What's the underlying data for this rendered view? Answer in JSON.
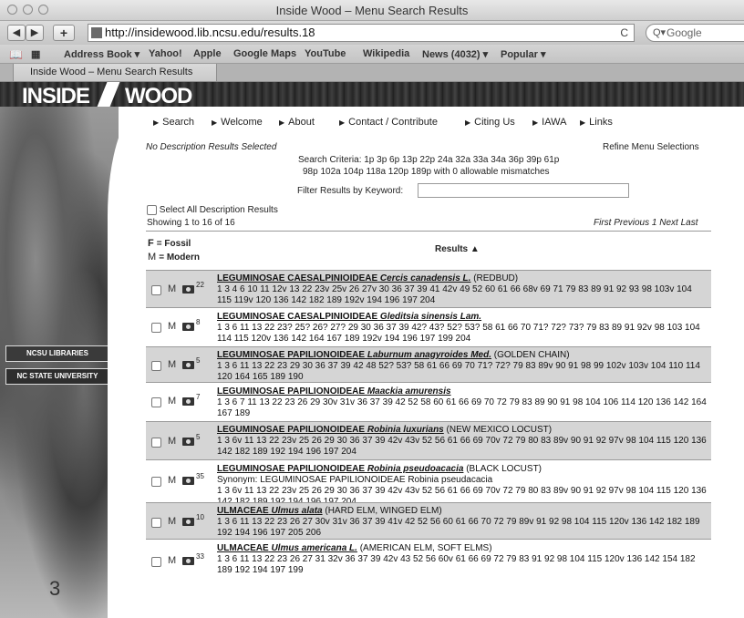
{
  "browser": {
    "window_title": "Inside Wood – Menu Search Results",
    "url": "http://insidewood.lib.ncsu.edu/results.18",
    "search_placeholder": "Google",
    "tab_title": "Inside Wood – Menu Search Results",
    "bookmarks": [
      "Address Book ▾",
      "Yahoo!",
      "Apple",
      "Google Maps",
      "YouTube",
      "Wikipedia",
      "News (4032) ▾",
      "Popular ▾"
    ]
  },
  "site": {
    "brand_left": "INSIDE",
    "brand_right": "WOOD",
    "library_badge": "NCSU LIBRARIES",
    "university_badge": "NC STATE UNIVERSITY",
    "page_number": "3"
  },
  "nav": [
    "Search",
    "Welcome",
    "About",
    "Contact / Contribute",
    "Citing Us",
    "IAWA",
    "Links"
  ],
  "criteria": {
    "no_description": "No Description Results Selected",
    "refine": "Refine Menu Selections",
    "line1": "Search Criteria: 1p 3p 6p 13p 22p 24a 32a 33a 34a 36p 39p 61p",
    "line2": "98p 102a 104p 118a 120p 189p with 0 allowable mismatches",
    "filter_label": "Filter Results by Keyword:",
    "filter_value": "",
    "select_all": "Select All Description Results",
    "showing": "Showing 1 to 16 of 16",
    "pager": "First Previous 1 Next Last"
  },
  "header": {
    "fossil_key": "F",
    "fossil_label": "= Fossil",
    "modern_key": "M",
    "modern_label": "= Modern",
    "results": "Results ▲"
  },
  "results": [
    {
      "family": "LEGUMINOSAE CAESALPINIOIDEAE",
      "species": "Cercis canadensis L.",
      "common": "(REDBUD)",
      "count": "22",
      "synonym": "",
      "codes": "1 3 4 6 10 11 12v 13 22 23v 25v 26 27v 30 36 37 39 41 42v 49 52 60 61 66 68v 69 71 79 83 89 91 92 93 98 103v 104 115 119v 120 136 142 182 189 192v 194 196 197 204"
    },
    {
      "family": "LEGUMINOSAE CAESALPINIOIDEAE",
      "species": "Gleditsia sinensis Lam.",
      "common": "",
      "count": "8",
      "synonym": "",
      "codes": "1 3 6 11 13 22 23? 25? 26? 27? 29 30 36 37 39 42? 43? 52? 53? 58 61 66 70 71? 72? 73? 79 83 89 91 92v 98 103 104 114 115 120v 136 142 164 167 189 192v 194 196 197 199 204"
    },
    {
      "family": "LEGUMINOSAE PAPILIONOIDEAE",
      "species": "Laburnum anagyroides Med.",
      "common": "(GOLDEN CHAIN)",
      "count": "5",
      "synonym": "",
      "codes": "1 3 6 11 13 22 23 29 30 36 37 39 42 48 52? 53? 58 61 66 69 70 71? 72? 79 83 89v 90 91 98 99 102v 103v 104 110 114 120 164 165 189 190"
    },
    {
      "family": "LEGUMINOSAE PAPILIONOIDEAE",
      "species": "Maackia amurensis",
      "common": "",
      "count": "7",
      "synonym": "",
      "codes": "1 3 6 7 11 13 22 23 26 29 30v 31v 36 37 39 42 52 58 60 61 66 69 70 72 79 83 89 90 91 98 104 106 114 120 136 142 164 167 189"
    },
    {
      "family": "LEGUMINOSAE PAPILIONOIDEAE",
      "species": "Robinia luxurians",
      "common": "(NEW MEXICO LOCUST)",
      "count": "5",
      "synonym": "",
      "codes": "1 3 6v 11 13 22 23v 25 26 29 30 36 37 39 42v 43v 52 56 61 66 69 70v 72 79 80 83 89v 90 91 92 97v 98 104 115 120 136 142 182 189 192 194 196 197 204"
    },
    {
      "family": "LEGUMINOSAE PAPILIONOIDEAE",
      "species": "Robinia pseudoacacia",
      "common": "(BLACK LOCUST)",
      "count": "35",
      "synonym": "Synonym: LEGUMINOSAE PAPILIONOIDEAE Robinia pseudacacia",
      "codes": "1 3 6v 11 13 22 23v 25 26 29 30 36 37 39 42v 43v 52 56 61 66 69 70v 72 79 80 83 89v 90 91 92 97v 98 104 115 120 136 142 182 189 192 194 196 197 204"
    },
    {
      "family": "ULMACEAE",
      "species": "Ulmus alata",
      "common": "(HARD ELM, WINGED ELM)",
      "count": "10",
      "synonym": "",
      "codes": "1 3 6 11 13 22 23 26 27 30v 31v 36 37 39 41v 42 52 56 60 61 66 70 72 79 89v 91 92 98 104 115 120v 136 142 182 189 192 194 196 197 205 206"
    },
    {
      "family": "ULMACEAE",
      "species": "Ulmus americana L.",
      "common": "(AMERICAN ELM, SOFT ELMS)",
      "count": "33",
      "synonym": "",
      "codes": "1 3 6 11 13 22 23 26 27 31 32v 36 37 39 42v 43 52 56 60v 61 66 69 72 79 83 91 92 98 104 115 120v 136 142 154 182 189 192 194 197 199"
    }
  ]
}
